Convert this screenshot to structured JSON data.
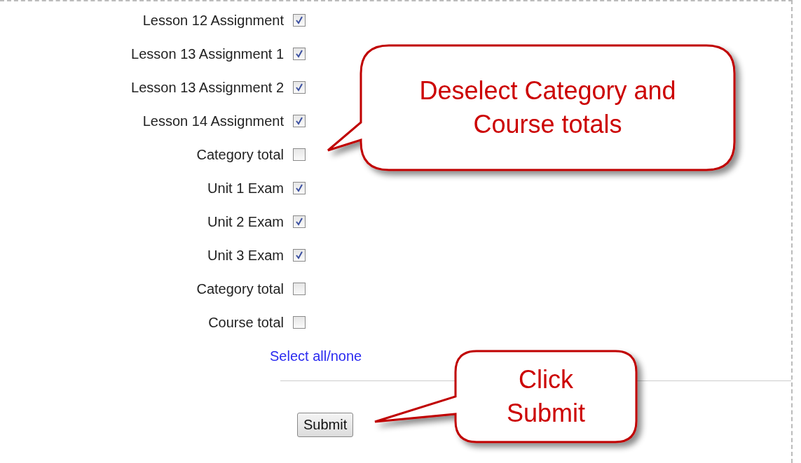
{
  "grade_items": [
    {
      "label": "Lesson 12 Assignment",
      "checked": true
    },
    {
      "label": "Lesson 13 Assignment 1",
      "checked": true
    },
    {
      "label": "Lesson 13 Assignment 2",
      "checked": true
    },
    {
      "label": "Lesson 14 Assignment",
      "checked": true
    },
    {
      "label": "Category total",
      "checked": false
    },
    {
      "label": "Unit 1 Exam",
      "checked": true
    },
    {
      "label": "Unit 2 Exam",
      "checked": true
    },
    {
      "label": "Unit 3 Exam",
      "checked": true
    },
    {
      "label": "Category total",
      "checked": false
    },
    {
      "label": "Course total",
      "checked": false
    }
  ],
  "select_link": "Select all/none",
  "submit_button": "Submit",
  "callouts": [
    {
      "text": "Deselect Category and Course totals"
    },
    {
      "text": "Click Submit"
    }
  ]
}
